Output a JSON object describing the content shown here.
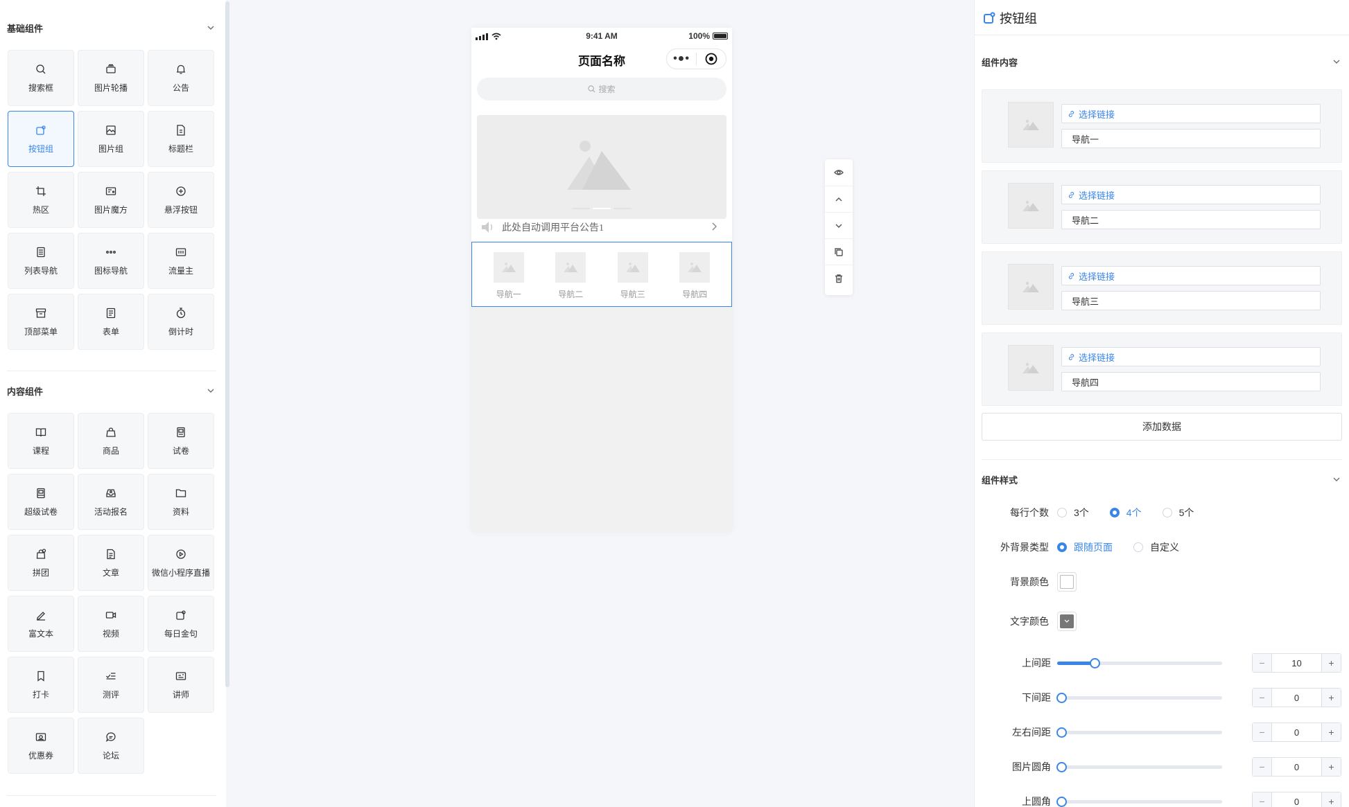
{
  "left": {
    "basic": {
      "title": "基础组件",
      "items": [
        {
          "label": "搜索框",
          "icon": "search-icon"
        },
        {
          "label": "图片轮播",
          "icon": "carousel-icon"
        },
        {
          "label": "公告",
          "icon": "bell-icon"
        },
        {
          "label": "按钮组",
          "icon": "button-group-icon"
        },
        {
          "label": "图片组",
          "icon": "image-icon"
        },
        {
          "label": "标题栏",
          "icon": "title-bar-icon"
        },
        {
          "label": "热区",
          "icon": "crop-icon"
        },
        {
          "label": "图片魔方",
          "icon": "image-cube-icon"
        },
        {
          "label": "悬浮按钮",
          "icon": "plus-circle-icon"
        },
        {
          "label": "列表导航",
          "icon": "list-nav-icon"
        },
        {
          "label": "图标导航",
          "icon": "dots-icon"
        },
        {
          "label": "流量主",
          "icon": "ad-icon"
        },
        {
          "label": "顶部菜单",
          "icon": "archive-icon"
        },
        {
          "label": "表单",
          "icon": "form-icon"
        },
        {
          "label": "倒计时",
          "icon": "timer-icon"
        }
      ]
    },
    "content": {
      "title": "内容组件",
      "items": [
        {
          "label": "课程",
          "icon": "book-icon"
        },
        {
          "label": "商品",
          "icon": "bag-icon"
        },
        {
          "label": "试卷",
          "icon": "exam-icon"
        },
        {
          "label": "超级试卷",
          "icon": "super-exam-icon"
        },
        {
          "label": "活动报名",
          "icon": "inbox-icon"
        },
        {
          "label": "资料",
          "icon": "folder-icon"
        },
        {
          "label": "拼团",
          "icon": "group-buy-icon"
        },
        {
          "label": "文章",
          "icon": "article-icon"
        },
        {
          "label": "微信小程序直播",
          "icon": "play-circle-icon"
        },
        {
          "label": "富文本",
          "icon": "pen-icon"
        },
        {
          "label": "视频",
          "icon": "video-icon"
        },
        {
          "label": "每日金句",
          "icon": "quote-icon"
        },
        {
          "label": "打卡",
          "icon": "bookmark-icon"
        },
        {
          "label": "测评",
          "icon": "check-list-icon"
        },
        {
          "label": "讲师",
          "icon": "teacher-icon"
        },
        {
          "label": "优惠券",
          "icon": "coupon-icon"
        },
        {
          "label": "论坛",
          "icon": "chat-icon"
        }
      ]
    }
  },
  "phone": {
    "time": "9:41 AM",
    "battery": "100%",
    "page_title": "页面名称",
    "capsule_dots": "•●•",
    "search_placeholder": "搜索",
    "notice": "此处自动调用平台公告1",
    "nav": [
      "导航一",
      "导航二",
      "导航三",
      "导航四"
    ]
  },
  "right": {
    "title": "按钮组",
    "content_section": "组件内容",
    "items": [
      {
        "link": "选择链接",
        "name": "导航一"
      },
      {
        "link": "选择链接",
        "name": "导航二"
      },
      {
        "link": "选择链接",
        "name": "导航三"
      },
      {
        "link": "选择链接",
        "name": "导航四"
      }
    ],
    "add_label": "添加数据",
    "style_section": "组件样式",
    "per_row": {
      "label": "每行个数",
      "options": [
        "3个",
        "4个",
        "5个"
      ],
      "selected": "4个"
    },
    "bg_type": {
      "label": "外背景类型",
      "options": [
        "跟随页面",
        "自定义"
      ],
      "selected": "跟随页面"
    },
    "bg_color": {
      "label": "背景颜色",
      "value": "#ffffff"
    },
    "text_color": {
      "label": "文字颜色",
      "value": "#777777"
    },
    "sliders": [
      {
        "label": "上间距",
        "value": "10",
        "fraction": 0.2
      },
      {
        "label": "下间距",
        "value": "0",
        "fraction": 0
      },
      {
        "label": "左右间距",
        "value": "0",
        "fraction": 0
      },
      {
        "label": "图片圆角",
        "value": "0",
        "fraction": 0
      },
      {
        "label": "上圆角",
        "value": "0",
        "fraction": 0
      }
    ],
    "minus": "−",
    "plus": "+"
  },
  "colors": {
    "accent": "#3a86e8"
  }
}
